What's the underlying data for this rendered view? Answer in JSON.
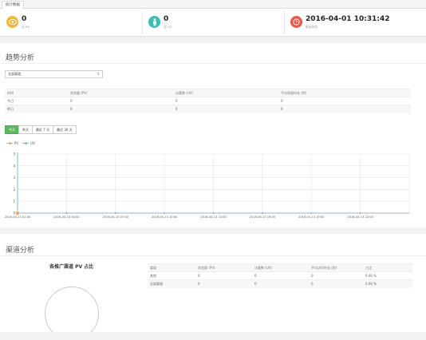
{
  "tab_label": "统计数据",
  "stats": [
    {
      "value": "0",
      "label": "总 PV",
      "color": "#f0b73a",
      "icon": "eye-icon"
    },
    {
      "value": "0",
      "label": "总 UV",
      "color": "#3bbdb1",
      "icon": "person-icon"
    },
    {
      "value": "2016-04-01 10:31:42",
      "label": "服务时间",
      "color": "#e8574a",
      "icon": "clock-icon"
    }
  ],
  "trend": {
    "title": "趋势分析",
    "channel_select": "全部渠道",
    "table": {
      "headers": [
        "时间",
        "浏览量 (PV)",
        "访客数 (UV)",
        "平均停留时长 (秒)"
      ],
      "rows": [
        [
          "今日",
          "0",
          "0",
          "0"
        ],
        [
          "昨日",
          "0",
          "0",
          "0"
        ]
      ]
    },
    "range_buttons": [
      "今天",
      "昨天",
      "最近 7 天",
      "最近 30 天"
    ],
    "legend": [
      {
        "name": "PV",
        "color": "#f4a460"
      },
      {
        "name": "UV",
        "color": "#7eb6e8"
      }
    ]
  },
  "chart_data": {
    "type": "line",
    "x": [
      "2016-04-13 01:00",
      "2016-04-13 04:00",
      "2016-04-13 07:00",
      "2016-04-13 10:00",
      "2016-04-13 13:00",
      "2016-04-13 16:00",
      "2016-04-13 19:00",
      "2016-04-13 22:00"
    ],
    "series": [
      {
        "name": "PV",
        "values": [
          0,
          0,
          0,
          0,
          0,
          0,
          0,
          0
        ]
      },
      {
        "name": "UV",
        "values": [
          0,
          0,
          0,
          0,
          0,
          0,
          0,
          0
        ]
      }
    ],
    "y_ticks": [
      "0",
      "1",
      "2",
      "3",
      "4",
      "5"
    ],
    "ylim": [
      0,
      5
    ],
    "grid": true
  },
  "channel": {
    "title": "渠道分析",
    "pie_title": "各推广渠道 PV 占比",
    "table": {
      "headers": [
        "渠道",
        "浏览量 (PV)",
        "访客数 (UV)",
        "平均访问时长 (秒)",
        "占比"
      ],
      "rows": [
        [
          "其他",
          "0",
          "0",
          "0",
          "0.00 %"
        ],
        [
          "全部渠道",
          "0",
          "0",
          "0",
          "0.00 %"
        ]
      ]
    }
  }
}
